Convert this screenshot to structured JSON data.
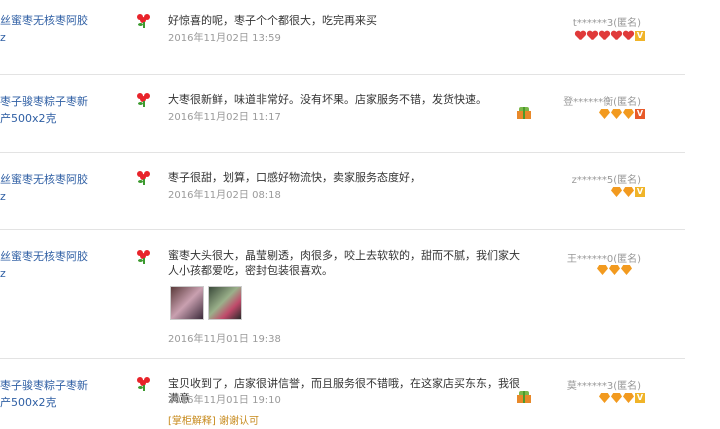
{
  "reviews": [
    {
      "product": [
        "丝蜜枣无核枣阿胶",
        "z"
      ],
      "comment": "好惊喜的呢，枣子个个都很大，吃完再来买",
      "date": "2016年11月02日 13:59",
      "user": "t******3(匿名)",
      "rank": {
        "icons": [
          "heart",
          "heart",
          "heart",
          "heart",
          "heart"
        ],
        "badge": "V"
      },
      "has_gift": false
    },
    {
      "product": [
        "枣子骏枣粽子枣新",
        "产500x2克"
      ],
      "comment": "大枣很新鲜，味道非常好。没有坏果。店家服务不错，发货快速。",
      "date": "2016年11月02日 11:17",
      "user": "登******衡(匿名)",
      "rank": {
        "icons": [
          "diamond",
          "diamond",
          "diamond"
        ],
        "badge": "V"
      },
      "has_gift": true
    },
    {
      "product": [
        "丝蜜枣无核枣阿胶",
        "z"
      ],
      "comment": "枣子很甜，划算，口感好物流快，卖家服务态度好，",
      "date": "2016年11月02日 08:18",
      "user": "z******5(匿名)",
      "rank": {
        "icons": [
          "diamond",
          "diamond"
        ],
        "badge": "V"
      },
      "has_gift": false
    },
    {
      "product": [
        "丝蜜枣无核枣阿胶",
        "z"
      ],
      "comment": "蜜枣大头很大，晶莹剔透，肉很多，咬上去软软的，甜而不腻，我们家大人小孩都爱吃，密封包装很喜欢。",
      "date": "2016年11月01日 19:38",
      "user": "王******0(匿名)",
      "rank": {
        "icons": [
          "diamond",
          "diamond",
          "diamond"
        ],
        "badge": ""
      },
      "has_gift": false
    },
    {
      "product": [
        "枣子骏枣粽子枣新",
        "产500x2克"
      ],
      "comment": "宝贝收到了，店家很讲信誉，而且服务很不错哦，在这家店买东东，我很满意",
      "date": "2016年11月01日 19:10",
      "user": "莫******3(匿名)",
      "rank": {
        "icons": [
          "diamond",
          "diamond",
          "diamond"
        ],
        "badge": "V"
      },
      "has_gift": true,
      "reply_tag": "[掌柜解释]",
      "reply_text": "谢谢认可"
    }
  ]
}
